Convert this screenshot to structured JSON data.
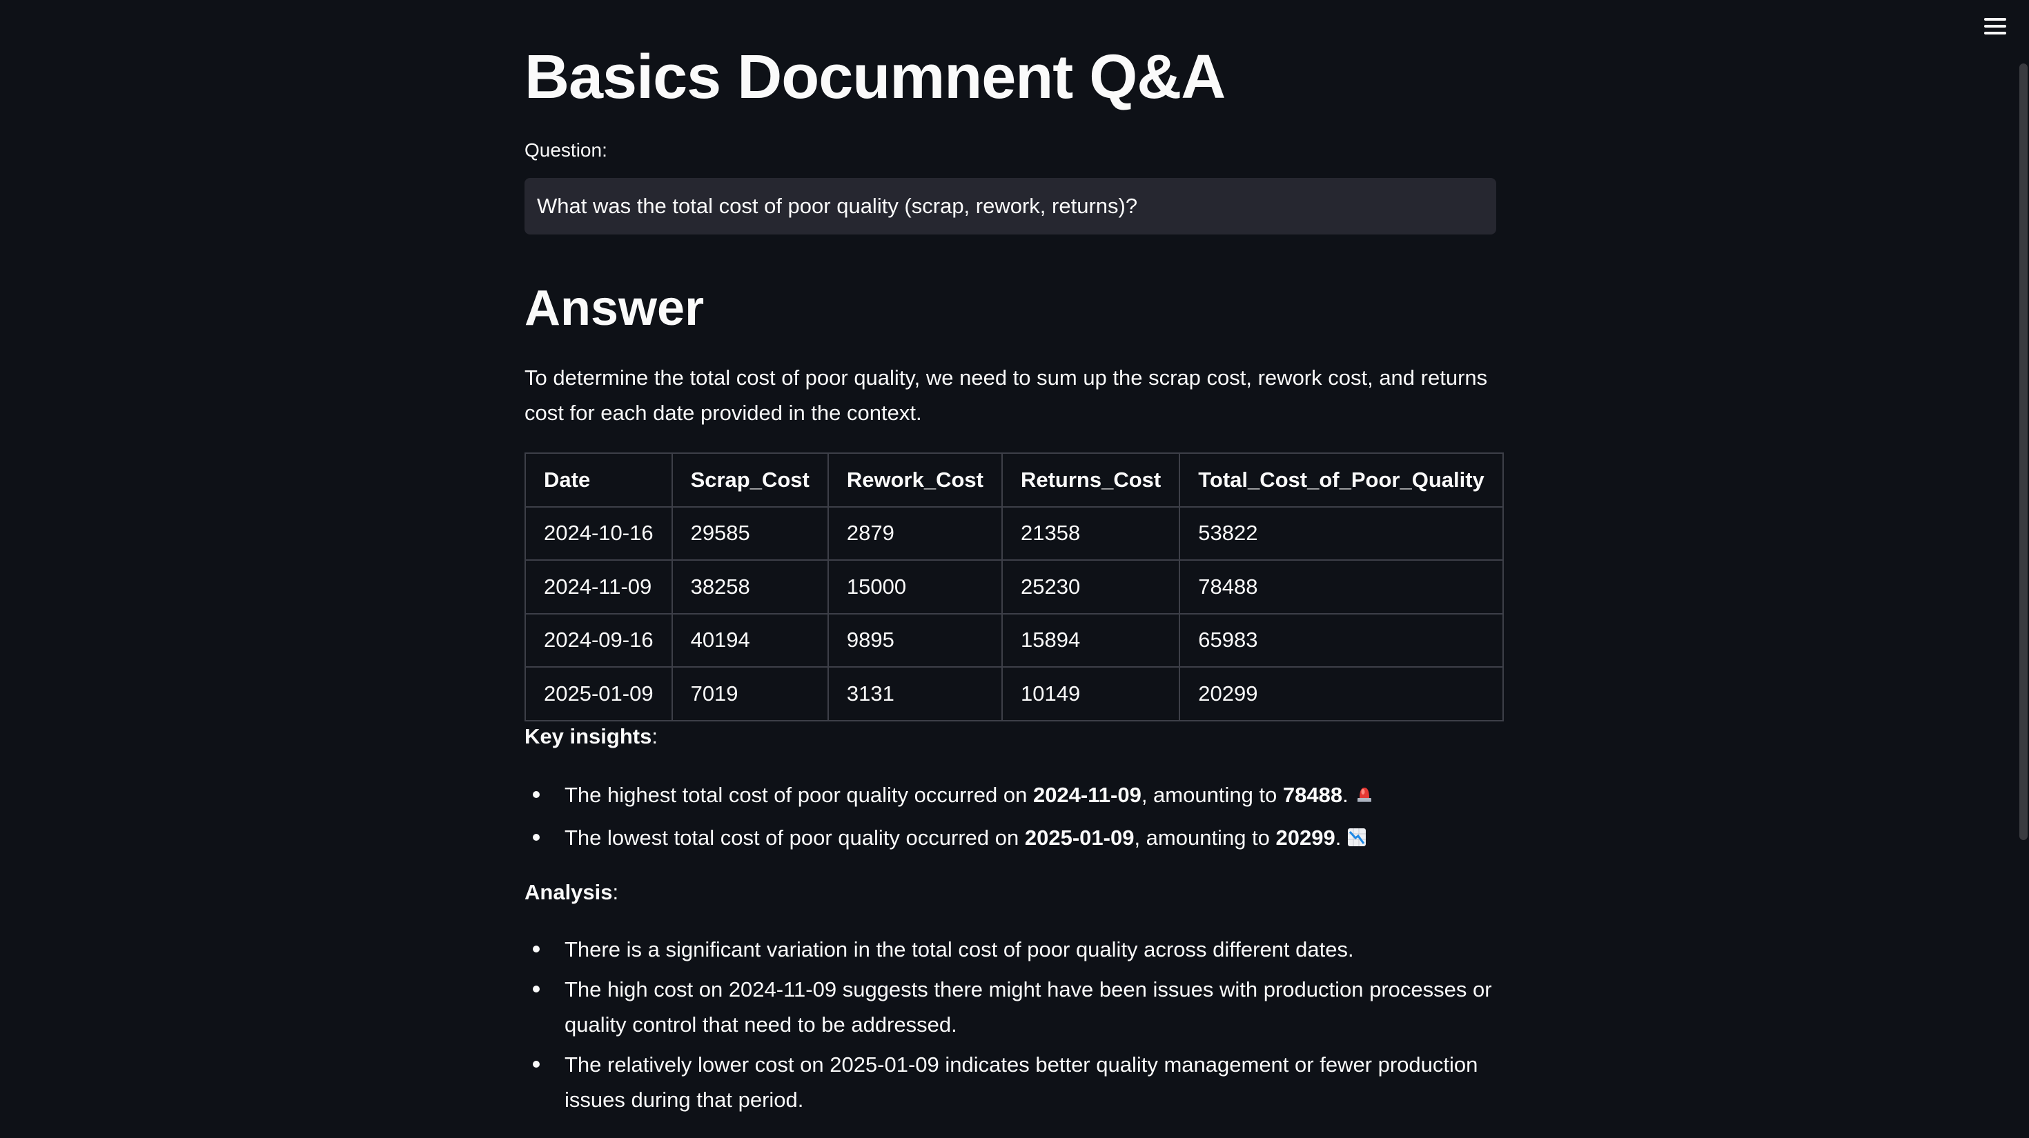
{
  "app": {
    "title": "Basics Documnent Q&A",
    "menu_icon": "hamburger-menu-icon"
  },
  "question": {
    "label": "Question:",
    "value": "What was the total cost of poor quality (scrap, rework, returns)?"
  },
  "answer": {
    "heading": "Answer",
    "intro": "To determine the total cost of poor quality, we need to sum up the scrap cost, rework cost, and returns cost for each date provided in the context.",
    "table": {
      "headers": [
        "Date",
        "Scrap_Cost",
        "Rework_Cost",
        "Returns_Cost",
        "Total_Cost_of_Poor_Quality"
      ],
      "rows": [
        [
          "2024-10-16",
          "29585",
          "2879",
          "21358",
          "53822"
        ],
        [
          "2024-11-09",
          "38258",
          "15000",
          "25230",
          "78488"
        ],
        [
          "2024-09-16",
          "40194",
          "9895",
          "15894",
          "65983"
        ],
        [
          "2025-01-09",
          "7019",
          "3131",
          "10149",
          "20299"
        ]
      ]
    },
    "insights": {
      "label": "Key insights",
      "colon": ":",
      "items": [
        {
          "prefix": "The highest total cost of poor quality occurred on ",
          "date": "2024-11-09",
          "middle": ", amounting to ",
          "amount": "78488",
          "suffix": ".",
          "icon": "rotating-light-icon"
        },
        {
          "prefix": "The lowest total cost of poor quality occurred on ",
          "date": "2025-01-09",
          "middle": ", amounting to ",
          "amount": "20299",
          "suffix": ".",
          "icon": "chart-decreasing-icon"
        }
      ]
    },
    "analysis": {
      "label": "Analysis",
      "colon": ":",
      "items": [
        "There is a significant variation in the total cost of poor quality across different dates.",
        "The high cost on 2024-11-09 suggests there might have been issues with production processes or quality control that need to be addressed.",
        "The relatively lower cost on 2025-01-09 indicates better quality management or fewer production issues during that period."
      ]
    }
  }
}
